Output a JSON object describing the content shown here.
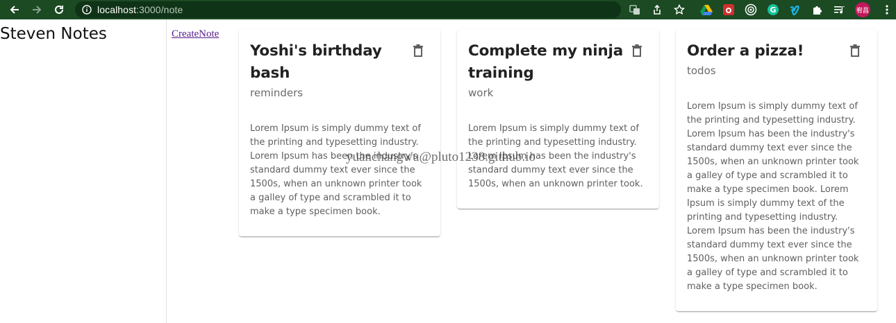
{
  "browser": {
    "url_host": "localhost",
    "url_path": ":3000/note",
    "profile_initials": "宥昌"
  },
  "app": {
    "title": "Steven Notes",
    "create_link": "CreateNote"
  },
  "notes": [
    {
      "title": "Yoshi's birthday bash",
      "category": "reminders",
      "details": "Lorem Ipsum is simply dummy text of the printing and typesetting industry. Lorem Ipsum has been the industry's standard dummy text ever since the 1500s, when an unknown printer took a galley of type and scrambled it to make a type specimen book."
    },
    {
      "title": "Complete my ninja training",
      "category": "work",
      "details": "Lorem Ipsum is simply dummy text of the printing and typesetting industry. Lorem Ipsum has been the industry's standard dummy text ever since the 1500s, when an unknown printer took."
    },
    {
      "title": "Order a pizza!",
      "category": "todos",
      "details": "Lorem Ipsum is simply dummy text of the printing and typesetting industry. Lorem Ipsum has been the industry's standard dummy text ever since the 1500s, when an unknown printer took a galley of type and scrambled it to make a type specimen book. Lorem Ipsum is simply dummy text of the printing and typesetting industry. Lorem Ipsum has been the industry's standard dummy text ever since the 1500s, when an unknown printer took a galley of type and scrambled it to make a type specimen book."
    }
  ],
  "watermark": "yuanchangwu@pluto1238.github.io"
}
